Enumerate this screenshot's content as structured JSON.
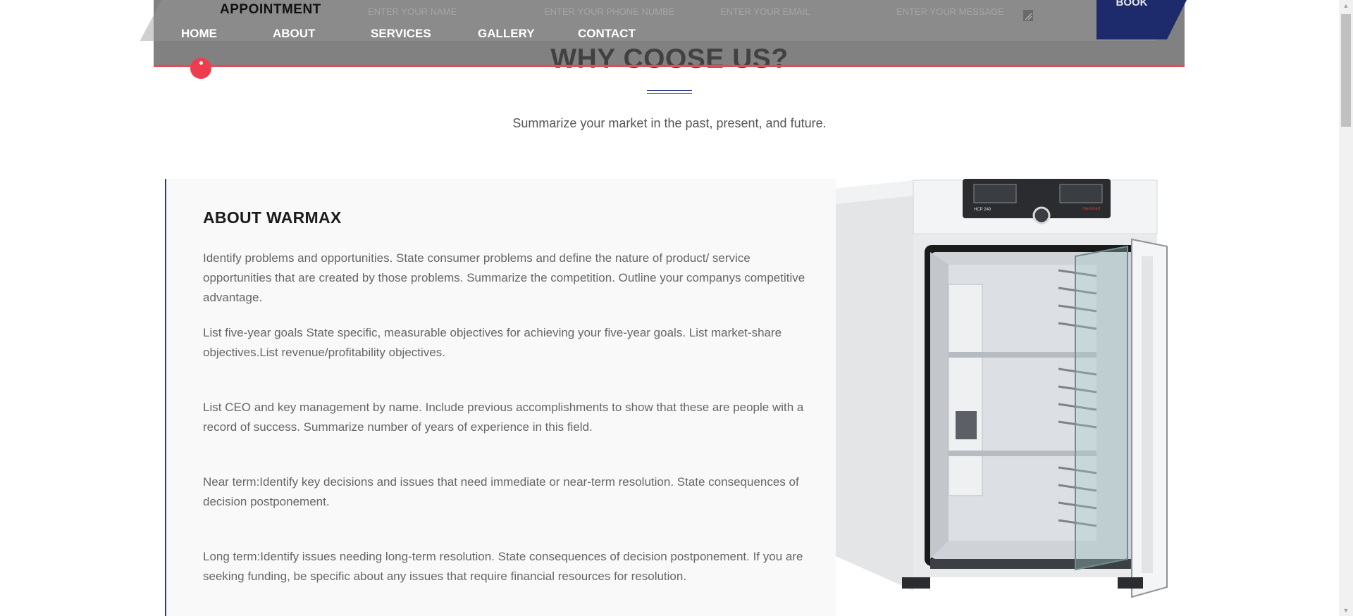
{
  "header": {
    "appointment_title": "APPOINTMENT",
    "inputs": {
      "name_placeholder": "ENTER YOUR NAME",
      "phone_placeholder": "ENTER YOUR PHONE NUMBE",
      "email_placeholder": "ENTER YOUR EMAIL",
      "message_placeholder": "ENTER YOUR MESSAGE"
    },
    "book_label": "BOOK",
    "nav": {
      "home": "HOME",
      "about": "ABOUT",
      "services": "SERVICES",
      "gallery": "GALLERY",
      "contact": "CONTACT"
    },
    "accent_color": "#e24b57",
    "button_color": "#1d2a6b"
  },
  "why": {
    "title": "WHY COOSE US?",
    "subtitle": "Summarize your market in the past, present, and future."
  },
  "about": {
    "heading": "ABOUT WARMAX",
    "paragraphs": [
      "Identify problems and opportunities. State consumer problems and define the nature of product/ service opportunities that are created by those problems. Summarize the competition. Outline your companys competitive advantage.",
      "List five-year goals State specific, measurable objectives for achieving your five-year goals. List market-share objectives.List revenue/profitability objectives.",
      "List CEO and key management by name. Include previous accomplishments to show that these are people with a record of success. Summarize number of years of experience in this field.",
      "Near term:Identify key decisions and issues that need immediate or near-term resolution. State consequences of decision postponement.",
      "Long term:Identify issues needing long-term resolution. State consequences of decision postponement. If you are seeking funding, be specific about any issues that require financial resources for resolution."
    ],
    "border_color": "#2d3b8e"
  },
  "product_image": {
    "icon": "incubator-oven-image",
    "brand_text": "memmert",
    "model_text": "HCP 240"
  }
}
